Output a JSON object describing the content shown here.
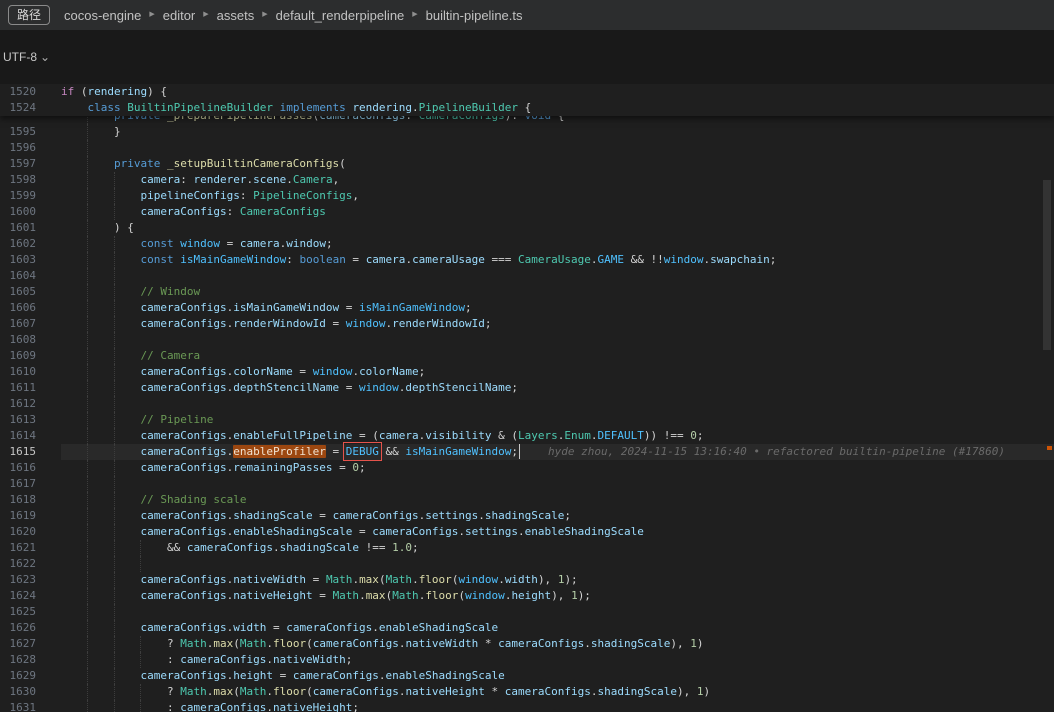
{
  "topbar": {
    "path_label": "路径",
    "breadcrumbs": [
      "cocos-engine",
      "editor",
      "assets",
      "default_renderpipeline",
      "builtin-pipeline.ts"
    ]
  },
  "encoding": {
    "label": "UTF-8"
  },
  "icons": {
    "breadcrumb_separator": "▶",
    "chevron_down": "⌄"
  },
  "colors": {
    "editor_background": "#1f1f1f",
    "match_highlight": "#ea5c00",
    "debug_selection_box": "#e5534b",
    "current_line": "#292929"
  },
  "editor": {
    "sticky_lines": [
      {
        "n": "1520",
        "s": [
          [
            "if",
            "ct"
          ],
          [
            " ("
          ],
          [
            "rendering",
            "v"
          ],
          [
            ") {"
          ]
        ]
      },
      {
        "n": "1524",
        "s": [
          [
            "    "
          ],
          [
            "class",
            "k"
          ],
          [
            " "
          ],
          [
            "BuiltinPipelineBuilder",
            "t"
          ],
          [
            " "
          ],
          [
            "implements",
            "k"
          ],
          [
            " "
          ],
          [
            "rendering",
            "v"
          ],
          [
            "."
          ],
          [
            "PipelineBuilder",
            "t"
          ],
          [
            " {"
          ]
        ]
      }
    ],
    "partial_line": {
      "n": "",
      "s": [
        [
          "        "
        ],
        [
          "private",
          "k"
        ],
        [
          " "
        ],
        [
          "_preparePipelinePasses",
          "f"
        ],
        [
          "("
        ],
        [
          "cameraConfigs",
          "v"
        ],
        [
          ": "
        ],
        [
          "CameraConfigs",
          "t"
        ],
        [
          "): "
        ],
        [
          "void",
          "k"
        ],
        [
          " {"
        ]
      ]
    },
    "lines": [
      {
        "n": "1595",
        "s": [
          [
            "        }"
          ]
        ]
      },
      {
        "n": "1596",
        "s": []
      },
      {
        "n": "1597",
        "s": [
          [
            "        "
          ],
          [
            "private",
            "k"
          ],
          [
            " "
          ],
          [
            "_setupBuiltinCameraConfigs",
            "f"
          ],
          [
            "("
          ]
        ]
      },
      {
        "n": "1598",
        "s": [
          [
            "            "
          ],
          [
            "camera",
            "v"
          ],
          [
            ": "
          ],
          [
            "renderer",
            "v"
          ],
          [
            "."
          ],
          [
            "scene",
            "v"
          ],
          [
            "."
          ],
          [
            "Camera",
            "t"
          ],
          [
            ","
          ]
        ]
      },
      {
        "n": "1599",
        "s": [
          [
            "            "
          ],
          [
            "pipelineConfigs",
            "v"
          ],
          [
            ": "
          ],
          [
            "PipelineConfigs",
            "t"
          ],
          [
            ","
          ]
        ]
      },
      {
        "n": "1600",
        "s": [
          [
            "            "
          ],
          [
            "cameraConfigs",
            "v"
          ],
          [
            ": "
          ],
          [
            "CameraConfigs",
            "t"
          ]
        ]
      },
      {
        "n": "1601",
        "s": [
          [
            "        ) {"
          ]
        ]
      },
      {
        "n": "1602",
        "s": [
          [
            "            "
          ],
          [
            "const",
            "k"
          ],
          [
            " "
          ],
          [
            "window",
            "cn"
          ],
          [
            " = "
          ],
          [
            "camera",
            "v"
          ],
          [
            "."
          ],
          [
            "window",
            "v"
          ],
          [
            ";"
          ]
        ]
      },
      {
        "n": "1603",
        "s": [
          [
            "            "
          ],
          [
            "const",
            "k"
          ],
          [
            " "
          ],
          [
            "isMainGameWindow",
            "cn"
          ],
          [
            ": "
          ],
          [
            "boolean",
            "k"
          ],
          [
            " = "
          ],
          [
            "camera",
            "v"
          ],
          [
            "."
          ],
          [
            "cameraUsage",
            "v"
          ],
          [
            " === "
          ],
          [
            "CameraUsage",
            "t"
          ],
          [
            "."
          ],
          [
            "GAME",
            "cn"
          ],
          [
            " && !!"
          ],
          [
            "window",
            "cn"
          ],
          [
            "."
          ],
          [
            "swapchain",
            "v"
          ],
          [
            ";"
          ]
        ]
      },
      {
        "n": "1604",
        "s": []
      },
      {
        "n": "1605",
        "s": [
          [
            "            "
          ],
          [
            "// Window",
            "m"
          ]
        ]
      },
      {
        "n": "1606",
        "s": [
          [
            "            "
          ],
          [
            "cameraConfigs",
            "v"
          ],
          [
            "."
          ],
          [
            "isMainGameWindow",
            "v"
          ],
          [
            " = "
          ],
          [
            "isMainGameWindow",
            "cn"
          ],
          [
            ";"
          ]
        ]
      },
      {
        "n": "1607",
        "s": [
          [
            "            "
          ],
          [
            "cameraConfigs",
            "v"
          ],
          [
            "."
          ],
          [
            "renderWindowId",
            "v"
          ],
          [
            " = "
          ],
          [
            "window",
            "cn"
          ],
          [
            "."
          ],
          [
            "renderWindowId",
            "v"
          ],
          [
            ";"
          ]
        ]
      },
      {
        "n": "1608",
        "s": []
      },
      {
        "n": "1609",
        "s": [
          [
            "            "
          ],
          [
            "// Camera",
            "m"
          ]
        ]
      },
      {
        "n": "1610",
        "s": [
          [
            "            "
          ],
          [
            "cameraConfigs",
            "v"
          ],
          [
            "."
          ],
          [
            "colorName",
            "v"
          ],
          [
            " = "
          ],
          [
            "window",
            "cn"
          ],
          [
            "."
          ],
          [
            "colorName",
            "v"
          ],
          [
            ";"
          ]
        ]
      },
      {
        "n": "1611",
        "s": [
          [
            "            "
          ],
          [
            "cameraConfigs",
            "v"
          ],
          [
            "."
          ],
          [
            "depthStencilName",
            "v"
          ],
          [
            " = "
          ],
          [
            "window",
            "cn"
          ],
          [
            "."
          ],
          [
            "depthStencilName",
            "v"
          ],
          [
            ";"
          ]
        ]
      },
      {
        "n": "1612",
        "s": []
      },
      {
        "n": "1613",
        "s": [
          [
            "            "
          ],
          [
            "// Pipeline",
            "m"
          ]
        ]
      },
      {
        "n": "1614",
        "s": [
          [
            "            "
          ],
          [
            "cameraConfigs",
            "v"
          ],
          [
            "."
          ],
          [
            "enableFullPipeline",
            "v"
          ],
          [
            " = ("
          ],
          [
            "camera",
            "v"
          ],
          [
            "."
          ],
          [
            "visibility",
            "v"
          ],
          [
            " & ("
          ],
          [
            "Layers",
            "t"
          ],
          [
            "."
          ],
          [
            "Enum",
            "t"
          ],
          [
            "."
          ],
          [
            "DEFAULT",
            "cn"
          ],
          [
            ")) !== "
          ],
          [
            "0",
            "n"
          ],
          [
            ";"
          ]
        ]
      },
      {
        "n": "1615",
        "cur": true,
        "cursor": true,
        "blame": "hyde zhou, 2024-11-15 13:16:40 • refactored builtin-pipeline (#17860)",
        "s": [
          [
            "            "
          ],
          [
            "cameraConfigs",
            "v"
          ],
          [
            "."
          ],
          [
            "enableProfiler",
            "match"
          ],
          [
            " = "
          ],
          [
            "DEBUG",
            "dbg"
          ],
          [
            " && "
          ],
          [
            "isMainGameWindow",
            "cn"
          ],
          [
            ";"
          ]
        ]
      },
      {
        "n": "1616",
        "s": [
          [
            "            "
          ],
          [
            "cameraConfigs",
            "v"
          ],
          [
            "."
          ],
          [
            "remainingPasses",
            "v"
          ],
          [
            " = "
          ],
          [
            "0",
            "n"
          ],
          [
            ";"
          ]
        ]
      },
      {
        "n": "1617",
        "s": []
      },
      {
        "n": "1618",
        "s": [
          [
            "            "
          ],
          [
            "// Shading scale",
            "m"
          ]
        ]
      },
      {
        "n": "1619",
        "s": [
          [
            "            "
          ],
          [
            "cameraConfigs",
            "v"
          ],
          [
            "."
          ],
          [
            "shadingScale",
            "v"
          ],
          [
            " = "
          ],
          [
            "cameraConfigs",
            "v"
          ],
          [
            "."
          ],
          [
            "settings",
            "v"
          ],
          [
            "."
          ],
          [
            "shadingScale",
            "v"
          ],
          [
            ";"
          ]
        ]
      },
      {
        "n": "1620",
        "s": [
          [
            "            "
          ],
          [
            "cameraConfigs",
            "v"
          ],
          [
            "."
          ],
          [
            "enableShadingScale",
            "v"
          ],
          [
            " = "
          ],
          [
            "cameraConfigs",
            "v"
          ],
          [
            "."
          ],
          [
            "settings",
            "v"
          ],
          [
            "."
          ],
          [
            "enableShadingScale",
            "v"
          ]
        ]
      },
      {
        "n": "1621",
        "s": [
          [
            "                && "
          ],
          [
            "cameraConfigs",
            "v"
          ],
          [
            "."
          ],
          [
            "shadingScale",
            "v"
          ],
          [
            " !== "
          ],
          [
            "1.0",
            "n"
          ],
          [
            ";"
          ]
        ]
      },
      {
        "n": "1622",
        "s": []
      },
      {
        "n": "1623",
        "s": [
          [
            "            "
          ],
          [
            "cameraConfigs",
            "v"
          ],
          [
            "."
          ],
          [
            "nativeWidth",
            "v"
          ],
          [
            " = "
          ],
          [
            "Math",
            "t"
          ],
          [
            "."
          ],
          [
            "max",
            "f"
          ],
          [
            "("
          ],
          [
            "Math",
            "t"
          ],
          [
            "."
          ],
          [
            "floor",
            "f"
          ],
          [
            "("
          ],
          [
            "window",
            "cn"
          ],
          [
            "."
          ],
          [
            "width",
            "v"
          ],
          [
            "), "
          ],
          [
            "1",
            "n"
          ],
          [
            ");"
          ]
        ]
      },
      {
        "n": "1624",
        "s": [
          [
            "            "
          ],
          [
            "cameraConfigs",
            "v"
          ],
          [
            "."
          ],
          [
            "nativeHeight",
            "v"
          ],
          [
            " = "
          ],
          [
            "Math",
            "t"
          ],
          [
            "."
          ],
          [
            "max",
            "f"
          ],
          [
            "("
          ],
          [
            "Math",
            "t"
          ],
          [
            "."
          ],
          [
            "floor",
            "f"
          ],
          [
            "("
          ],
          [
            "window",
            "cn"
          ],
          [
            "."
          ],
          [
            "height",
            "v"
          ],
          [
            "), "
          ],
          [
            "1",
            "n"
          ],
          [
            ");"
          ]
        ]
      },
      {
        "n": "1625",
        "s": []
      },
      {
        "n": "1626",
        "s": [
          [
            "            "
          ],
          [
            "cameraConfigs",
            "v"
          ],
          [
            "."
          ],
          [
            "width",
            "v"
          ],
          [
            " = "
          ],
          [
            "cameraConfigs",
            "v"
          ],
          [
            "."
          ],
          [
            "enableShadingScale",
            "v"
          ]
        ]
      },
      {
        "n": "1627",
        "s": [
          [
            "                ? "
          ],
          [
            "Math",
            "t"
          ],
          [
            "."
          ],
          [
            "max",
            "f"
          ],
          [
            "("
          ],
          [
            "Math",
            "t"
          ],
          [
            "."
          ],
          [
            "floor",
            "f"
          ],
          [
            "("
          ],
          [
            "cameraConfigs",
            "v"
          ],
          [
            "."
          ],
          [
            "nativeWidth",
            "v"
          ],
          [
            " * "
          ],
          [
            "cameraConfigs",
            "v"
          ],
          [
            "."
          ],
          [
            "shadingScale",
            "v"
          ],
          [
            "), "
          ],
          [
            "1",
            "n"
          ],
          [
            ")"
          ]
        ]
      },
      {
        "n": "1628",
        "s": [
          [
            "                : "
          ],
          [
            "cameraConfigs",
            "v"
          ],
          [
            "."
          ],
          [
            "nativeWidth",
            "v"
          ],
          [
            ";"
          ]
        ]
      },
      {
        "n": "1629",
        "s": [
          [
            "            "
          ],
          [
            "cameraConfigs",
            "v"
          ],
          [
            "."
          ],
          [
            "height",
            "v"
          ],
          [
            " = "
          ],
          [
            "cameraConfigs",
            "v"
          ],
          [
            "."
          ],
          [
            "enableShadingScale",
            "v"
          ]
        ]
      },
      {
        "n": "1630",
        "s": [
          [
            "                ? "
          ],
          [
            "Math",
            "t"
          ],
          [
            "."
          ],
          [
            "max",
            "f"
          ],
          [
            "("
          ],
          [
            "Math",
            "t"
          ],
          [
            "."
          ],
          [
            "floor",
            "f"
          ],
          [
            "("
          ],
          [
            "cameraConfigs",
            "v"
          ],
          [
            "."
          ],
          [
            "nativeHeight",
            "v"
          ],
          [
            " * "
          ],
          [
            "cameraConfigs",
            "v"
          ],
          [
            "."
          ],
          [
            "shadingScale",
            "v"
          ],
          [
            "), "
          ],
          [
            "1",
            "n"
          ],
          [
            ")"
          ]
        ]
      },
      {
        "n": "1631",
        "s": [
          [
            "                : "
          ],
          [
            "cameraConfigs",
            "v"
          ],
          [
            "."
          ],
          [
            "nativeHeight",
            "v"
          ],
          [
            ";"
          ]
        ]
      }
    ]
  }
}
